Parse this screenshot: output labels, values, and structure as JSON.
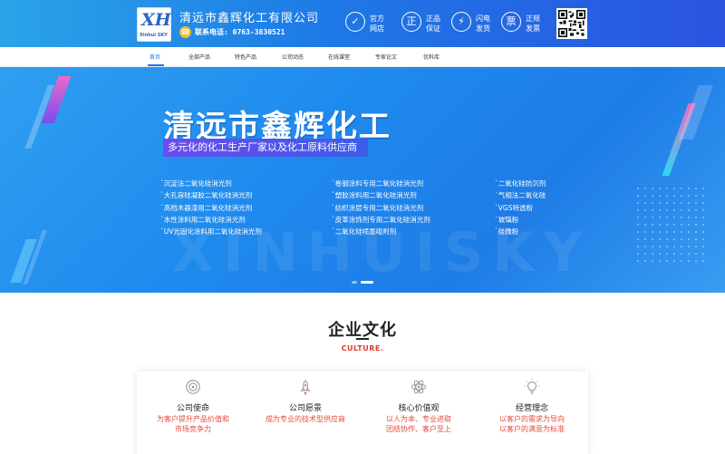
{
  "header": {
    "logo_text": "XH",
    "logo_sub": "Xinhui SKY",
    "company_name": "清远市鑫辉化工有限公司",
    "hotline_label": "联系电话:",
    "hotline_number": "0763-3830521",
    "badges": [
      {
        "icon": "shield-check-icon",
        "glyph": "✓",
        "line1": "官方",
        "line2": "网店"
      },
      {
        "icon": "genuine-icon",
        "glyph": "正",
        "line1": "正品",
        "line2": "保证"
      },
      {
        "icon": "lightning-icon",
        "glyph": "⚡",
        "line1": "闪电",
        "line2": "发货"
      },
      {
        "icon": "invoice-icon",
        "glyph": "票",
        "line1": "正规",
        "line2": "发票"
      }
    ]
  },
  "nav": {
    "items": [
      "首页",
      "全部产品",
      "特色产品",
      "公司动态",
      "在线课堂",
      "专家论文",
      "优料库"
    ],
    "active_index": 0,
    "active_color": "#1e79e6"
  },
  "banner": {
    "title": "清远市鑫辉化工",
    "subtitle": "多元化的化工生产厂家以及化工原料供应商",
    "watermark": "XINHUISKY",
    "products_col1": [
      "沉淀法二氧化硅消光剂",
      "大孔容硅凝胶二氧化硅消光剂",
      "高档木器漆用二氧化硅消光剂",
      "水性涂料用二氧化硅消光剂",
      "UV光固化涂料用二氧化硅消光剂"
    ],
    "products_col2": [
      "卷钢涂料专用二氧化硅消光剂",
      "塑胶涂料用二氧化硅消光剂",
      "纺织涂层专用二氧化硅消光剂",
      "皮革涂饰剂专用二氧化硅消光剂",
      "二氧化硅喷墨吸附剂"
    ],
    "products_col3": [
      "二氧化硅防沉剂",
      "气相法二氧化硅",
      "VGS特透粉",
      "玻璃粉",
      "硅微粉"
    ],
    "slide_count": 2,
    "active_slide": 1
  },
  "culture": {
    "title": "企业文化",
    "subtitle": "CULTURE.",
    "cards": [
      {
        "icon": "target-icon",
        "title": "公司使命",
        "desc_lines": [
          "为客户提升产品价值和",
          "市场竞争力"
        ]
      },
      {
        "icon": "rocket-icon",
        "title": "公司愿景",
        "desc_lines": [
          "成为专业的技术型供应商"
        ]
      },
      {
        "icon": "atom-icon",
        "title": "核心价值观",
        "desc_lines": [
          "以人为本、专业进取",
          "团结协作、客户至上"
        ]
      },
      {
        "icon": "lightbulb-icon",
        "title": "经营理念",
        "desc_lines": [
          "以客户的需求为导向",
          "以客户的满意为标准"
        ]
      }
    ]
  },
  "colors": {
    "header_start": "#2aa4e8",
    "header_end": "#2b53e0",
    "accent_red": "#e23a2a",
    "card_desc": "#e84a3a"
  }
}
